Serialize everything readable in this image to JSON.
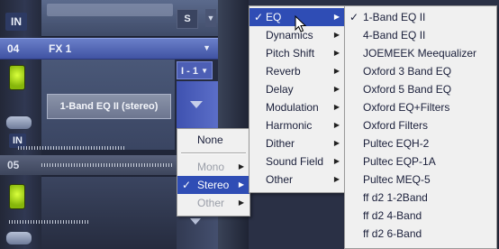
{
  "mixer": {
    "in_label_top": "IN",
    "in_label_mid": "IN",
    "s_label": "S",
    "fx_channel_number": "04",
    "fx_channel_name": "FX 1",
    "io_label": "I - 1",
    "plugin_slot_label": "1-Band EQ II (stereo)",
    "channel_05_number": "05",
    "accent_blue": "#4053a3",
    "led_color": "#b8e81e"
  },
  "context_menu": {
    "items": [
      {
        "label": "None",
        "check": "",
        "has_submenu": false,
        "disabled": false,
        "selected": false
      },
      {
        "label": "Mono",
        "check": "",
        "has_submenu": true,
        "disabled": true,
        "selected": false
      },
      {
        "label": "Stereo",
        "check": "✓",
        "has_submenu": true,
        "disabled": false,
        "selected": true
      },
      {
        "label": "Other",
        "check": "",
        "has_submenu": true,
        "disabled": true,
        "selected": false
      }
    ]
  },
  "category_menu": {
    "items": [
      {
        "label": "EQ",
        "check": "✓",
        "selected": true
      },
      {
        "label": "Dynamics",
        "check": "",
        "selected": false
      },
      {
        "label": "Pitch Shift",
        "check": "",
        "selected": false
      },
      {
        "label": "Reverb",
        "check": "",
        "selected": false
      },
      {
        "label": "Delay",
        "check": "",
        "selected": false
      },
      {
        "label": "Modulation",
        "check": "",
        "selected": false
      },
      {
        "label": "Harmonic",
        "check": "",
        "selected": false
      },
      {
        "label": "Dither",
        "check": "",
        "selected": false
      },
      {
        "label": "Sound Field",
        "check": "",
        "selected": false
      },
      {
        "label": "Other",
        "check": "",
        "selected": false
      }
    ],
    "selection_color": "#2f4db5"
  },
  "plugin_menu": {
    "items": [
      {
        "label": "1-Band EQ II",
        "check": "✓"
      },
      {
        "label": "4-Band EQ II",
        "check": ""
      },
      {
        "label": "JOEMEEK Meequalizer",
        "check": ""
      },
      {
        "label": "Oxford 3 Band EQ",
        "check": ""
      },
      {
        "label": "Oxford 5 Band EQ",
        "check": ""
      },
      {
        "label": "Oxford EQ+Filters",
        "check": ""
      },
      {
        "label": "Oxford Filters",
        "check": ""
      },
      {
        "label": "Pultec EQH-2",
        "check": ""
      },
      {
        "label": "Pultec EQP-1A",
        "check": ""
      },
      {
        "label": "Pultec MEQ-5",
        "check": ""
      },
      {
        "label": "ff d2 1-2Band",
        "check": ""
      },
      {
        "label": "ff d2 4-Band",
        "check": ""
      },
      {
        "label": "ff d2 6-Band",
        "check": ""
      }
    ]
  },
  "icons": {
    "submenu_arrow": "▶",
    "dropdown_caret": "▼",
    "cursor": "mouse-pointer-icon"
  }
}
